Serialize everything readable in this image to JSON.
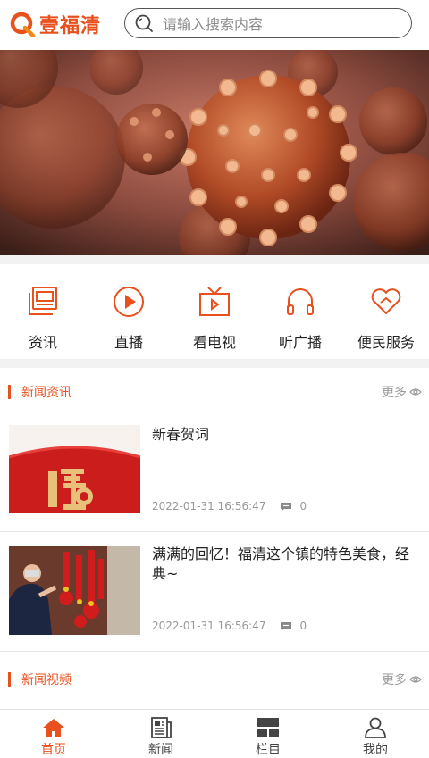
{
  "header": {
    "logo_text": "壹福清",
    "search_placeholder": "请输入搜索内容"
  },
  "quicknav": [
    {
      "label": "资讯",
      "icon": "news-doc-icon"
    },
    {
      "label": "直播",
      "icon": "play-circle-icon"
    },
    {
      "label": "看电视",
      "icon": "tv-icon"
    },
    {
      "label": "听广播",
      "icon": "headphones-icon"
    },
    {
      "label": "便民服务",
      "icon": "heart-icon"
    }
  ],
  "sections": {
    "news": {
      "title": "新闻资讯",
      "more": "更多"
    },
    "video": {
      "title": "新闻视频",
      "more": "更多"
    }
  },
  "news_items": [
    {
      "title": "新春贺词",
      "time": "2022-01-31 16:56:47",
      "comments": "0"
    },
    {
      "title": "满满的回忆！福清这个镇的特色美食，经典~",
      "time": "2022-01-31 16:56:47",
      "comments": "0"
    }
  ],
  "tabs": [
    {
      "label": "首页",
      "icon": "home-icon",
      "active": true
    },
    {
      "label": "新闻",
      "icon": "newspaper-icon",
      "active": false
    },
    {
      "label": "栏目",
      "icon": "grid-icon",
      "active": false
    },
    {
      "label": "我的",
      "icon": "user-icon",
      "active": false
    }
  ],
  "colors": {
    "accent": "#e8501e",
    "muted": "#999999",
    "divider": "#f2f2f2"
  }
}
